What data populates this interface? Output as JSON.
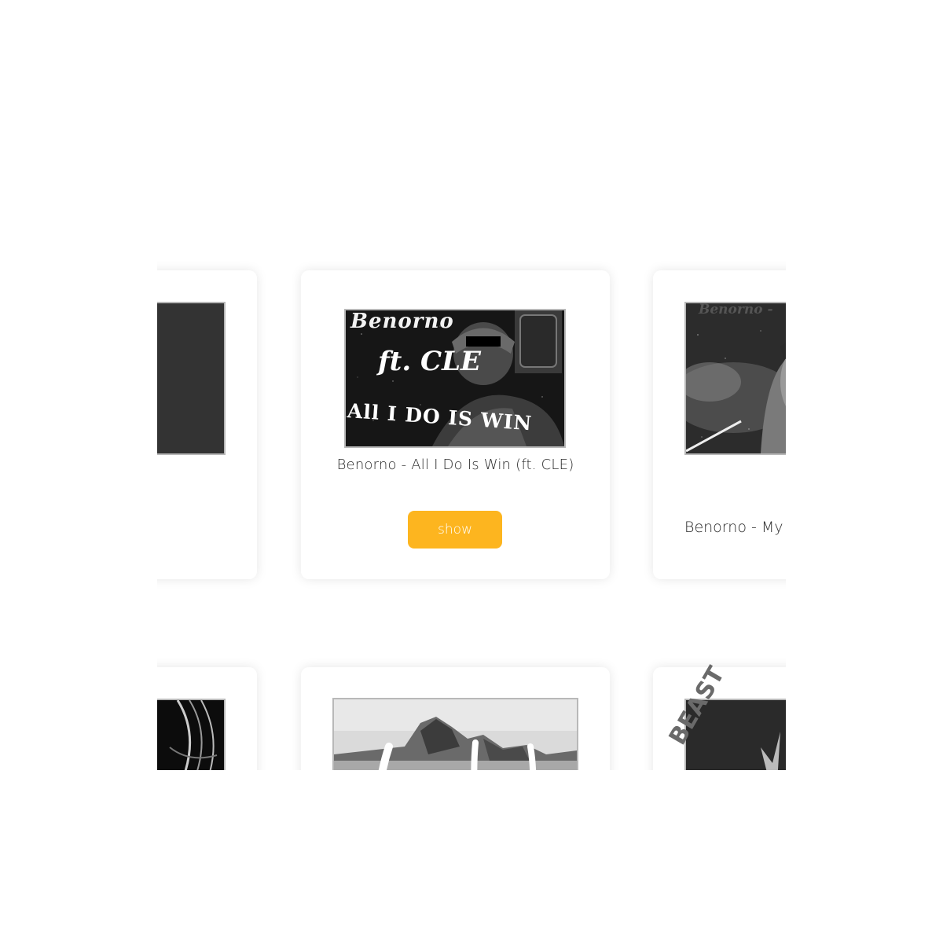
{
  "carousel": {
    "center_card": {
      "title": "Benorno - All I Do Is Win (ft. CLE)",
      "show_label": "show",
      "cover_art": {
        "line1": "Benorno",
        "line2": "ft. CLE",
        "line3": "All I DO IS WIN"
      }
    },
    "right_card": {
      "title": "Benorno - My",
      "cover_art": {
        "line1": "Benorno - "
      }
    },
    "bottom_right_card": {
      "cover_art": {
        "line1": "BEAST"
      }
    }
  },
  "colors": {
    "accent": "#fdb51f",
    "card_background": "#ffffff",
    "image_border": "#b8b8b8"
  }
}
